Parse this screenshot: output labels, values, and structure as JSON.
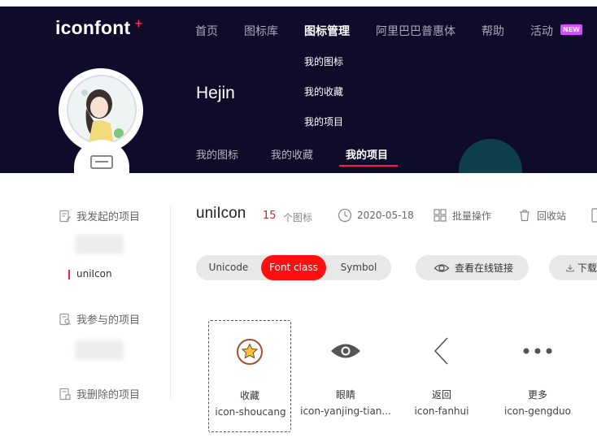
{
  "header": {
    "logo": "iconfont",
    "logo_plus": "+",
    "nav": [
      "首页",
      "图标库",
      "图标管理",
      "阿里巴巴普惠体",
      "帮助",
      "活动"
    ],
    "nav_active": "图标管理",
    "badge": "NEW",
    "submenu": [
      "我的图标",
      "我的收藏",
      "我的项目"
    ],
    "username": "Hejin",
    "profile_tabs": [
      "我的图标",
      "我的收藏",
      "我的项目"
    ],
    "profile_tab_active": "我的项目"
  },
  "sidebar": {
    "created_heading": "我发起的项目",
    "active_project": "uniIcon",
    "joined_heading": "我参与的项目",
    "deleted_heading": "我删除的项目"
  },
  "project": {
    "title": "uniIcon",
    "count": "15",
    "count_label": "个图标",
    "date": "2020-05-18",
    "batch_label": "批量操作",
    "recycle_label": "回收站"
  },
  "toolbar": {
    "formats": [
      "Unicode",
      "Font class",
      "Symbol"
    ],
    "format_active": "Font class",
    "view_link_label": "查看在线链接",
    "download_label": "下载"
  },
  "icons": [
    {
      "name": "收藏",
      "class": "icon-shoucang",
      "glyph": "star-circle-icon",
      "selected": true
    },
    {
      "name": "眼睛",
      "class": "icon-yanjing-tian...",
      "glyph": "eye-icon",
      "selected": false
    },
    {
      "name": "返回",
      "class": "icon-fanhui",
      "glyph": "chevron-left-icon",
      "selected": false
    },
    {
      "name": "更多",
      "class": "icon-gengduo",
      "glyph": "more-dots-icon",
      "selected": false
    }
  ],
  "colors": {
    "header_bg": "#0f0c2b",
    "accent_red": "#ff0f0f",
    "count_red": "#e02020",
    "star_gold": "#f6c23a",
    "star_ring": "#a0522d"
  }
}
